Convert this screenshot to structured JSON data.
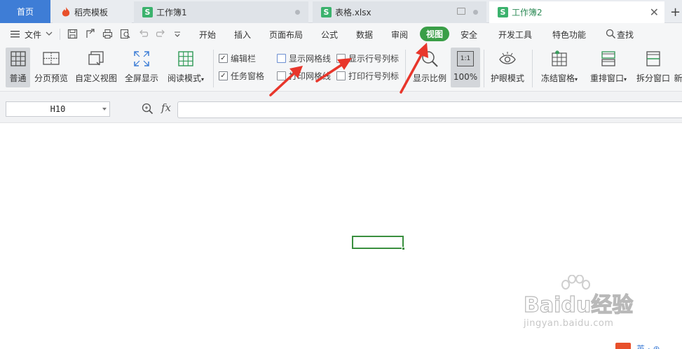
{
  "tabs": {
    "home": "首页",
    "template": "稻壳模板",
    "workbook1": "工作簿1",
    "xlsx": "表格.xlsx",
    "workbook2": "工作簿2",
    "add": "+"
  },
  "menu": {
    "file": "文件",
    "items": [
      "开始",
      "插入",
      "页面布局",
      "公式",
      "数据",
      "审阅",
      "视图",
      "安全",
      "开发工具",
      "特色功能"
    ],
    "active": "视图",
    "search": "查找"
  },
  "ribbon": {
    "normal": "普通",
    "page_break_preview": "分页预览",
    "custom_view": "自定义视图",
    "full_screen": "全屏显示",
    "reading_mode": "阅读模式",
    "edit_bar": "编辑栏",
    "task_pane": "任务窗格",
    "show_gridlines": "显示网格线",
    "print_gridlines": "打印网格线",
    "show_row_col_headers": "显示行号列标",
    "print_row_col_headers": "打印行号列标",
    "zoom": "显示比例",
    "zoom_100": "100%",
    "zoom_100_icon_text": "1:1",
    "eye_protection": "护眼模式",
    "freeze_panes": "冻结窗格",
    "arrange_windows": "重排窗口",
    "split_window": "拆分窗口",
    "new_window": "新"
  },
  "checkboxes": {
    "edit_bar": true,
    "task_pane": true,
    "show_gridlines": false,
    "print_gridlines": false,
    "show_row_col_headers": false,
    "print_row_col_headers": false
  },
  "formula_bar": {
    "cell_ref": "H10",
    "fx": "fx",
    "value": ""
  },
  "watermark": {
    "main": "Baidu经验",
    "sub": "jingyan.baidu.com"
  },
  "colors": {
    "accent_green": "#3a9e47",
    "home_tab_blue": "#3e7dd6",
    "arrow_red": "#e8362b"
  }
}
